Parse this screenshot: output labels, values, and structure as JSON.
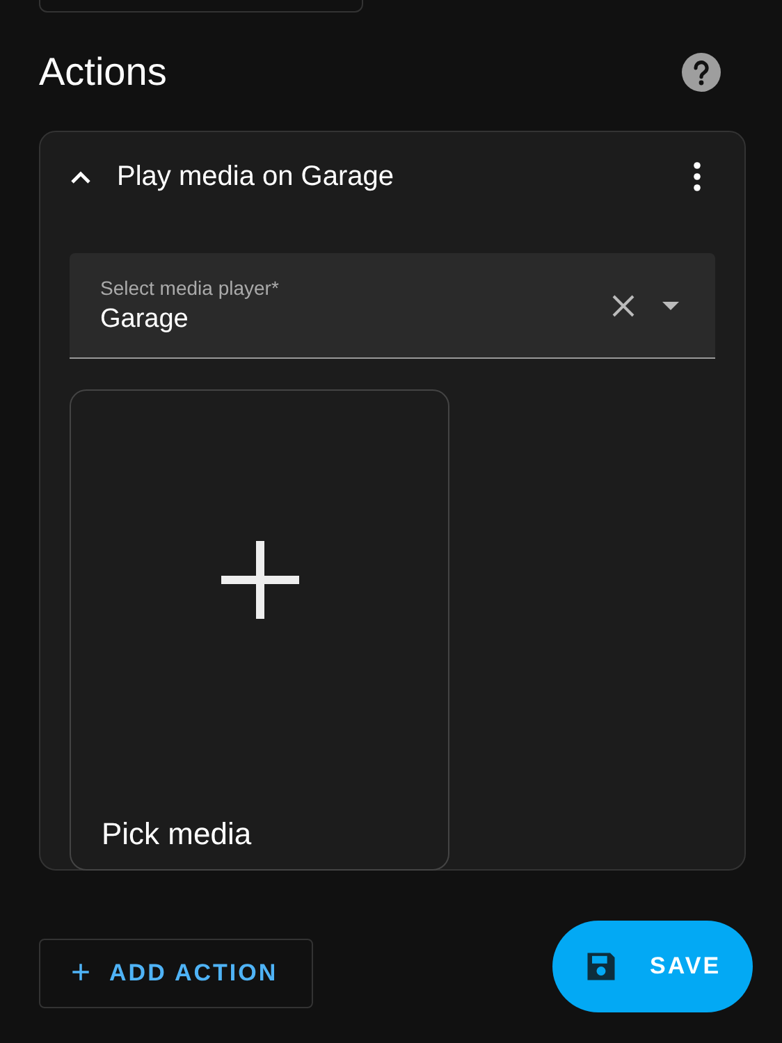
{
  "section": {
    "title": "Actions"
  },
  "action": {
    "title": "Play media on Garage",
    "expanded": true,
    "field": {
      "label": "Select media player*",
      "value": "Garage"
    },
    "media_tile": {
      "label": "Pick media"
    }
  },
  "add_button": {
    "label": "ADD ACTION",
    "icon": "+"
  },
  "save_button": {
    "label": "SAVE"
  }
}
